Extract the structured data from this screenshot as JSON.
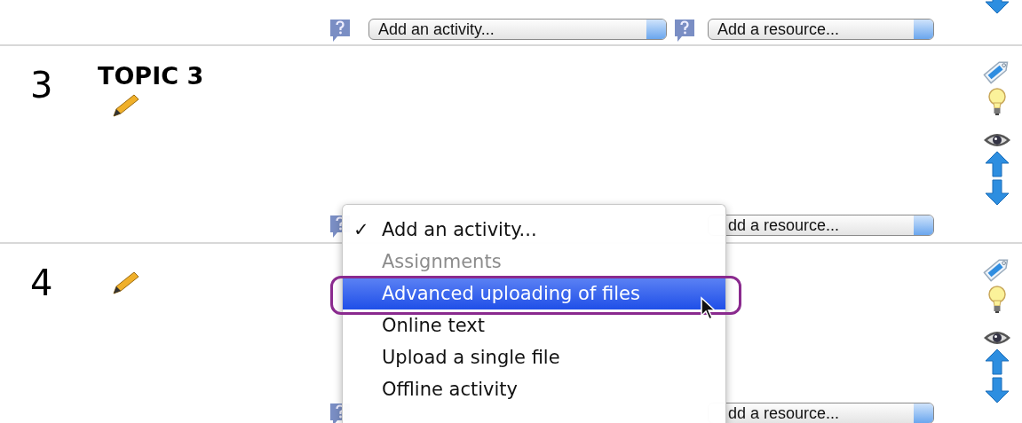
{
  "sections": [
    {
      "kind": "partial",
      "icons": [
        {
          "kind": "down"
        }
      ],
      "controls": {
        "help_before_activity": true,
        "activity_select": "Add an activity...",
        "help_before_resource": true,
        "resource_select": "Add a resource..."
      }
    },
    {
      "kind": "topic",
      "number": "3",
      "title": "TOPIC 3",
      "icons": [
        {
          "kind": "tag"
        },
        {
          "kind": "bulb"
        },
        {
          "kind": "eye"
        },
        {
          "kind": "up"
        },
        {
          "kind": "down"
        }
      ],
      "controls": {
        "help_before_activity": true,
        "help_before_resource": false,
        "resource_select": "dd a resource..."
      }
    },
    {
      "kind": "topic",
      "number": "4",
      "icons": [
        {
          "kind": "tag"
        },
        {
          "kind": "bulb"
        },
        {
          "kind": "eye"
        },
        {
          "kind": "up"
        },
        {
          "kind": "down"
        }
      ],
      "controls": {
        "help_before_activity": true,
        "help_before_resource": false,
        "resource_select": "dd a resource..."
      }
    }
  ],
  "menu": {
    "items": [
      {
        "label": "Add an activity...",
        "checked": true,
        "disabled": false,
        "selected": false
      },
      {
        "label": "Assignments",
        "checked": false,
        "disabled": true,
        "selected": false
      },
      {
        "label": "Advanced uploading of files",
        "checked": false,
        "disabled": false,
        "selected": true
      },
      {
        "label": "Online text",
        "checked": false,
        "disabled": false,
        "selected": false
      },
      {
        "label": "Upload a single file",
        "checked": false,
        "disabled": false,
        "selected": false
      },
      {
        "label": "Offline activity",
        "checked": false,
        "disabled": false,
        "selected": false
      }
    ],
    "check_mark": "✓"
  }
}
